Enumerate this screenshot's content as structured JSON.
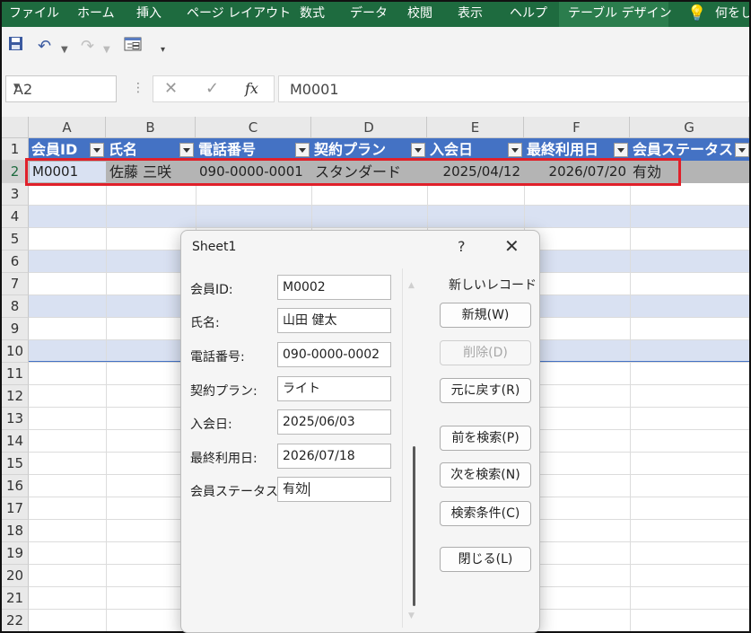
{
  "ribbon": {
    "tabs": [
      "ファイル",
      "ホーム",
      "挿入",
      "ページ レイアウト",
      "数式",
      "データ",
      "校閲",
      "表示",
      "ヘルプ",
      "テーブル デザイン"
    ],
    "tell_me": "何をし"
  },
  "formula_bar": {
    "name_box": "A2",
    "content": "M0001",
    "fx": "fx"
  },
  "grid": {
    "columns": [
      "A",
      "B",
      "C",
      "D",
      "E",
      "F",
      "G"
    ],
    "rows": [
      "1",
      "2",
      "3",
      "4",
      "5",
      "6",
      "7",
      "8",
      "9",
      "10",
      "11",
      "12",
      "13",
      "14",
      "15",
      "16",
      "17",
      "18",
      "19",
      "20",
      "21",
      "22"
    ],
    "header": [
      "会員ID",
      "氏名",
      "電話番号",
      "契約プラン",
      "入会日",
      "最終利用日",
      "会員ステータス"
    ],
    "record": [
      "M0001",
      "佐藤 三咲",
      "090-0000-0001",
      "スタンダード",
      "2025/04/12",
      "2026/07/20",
      "有効"
    ]
  },
  "dialog": {
    "title": "Sheet1",
    "help": "?",
    "close": "✕",
    "record_label": "新しいレコード",
    "fields": [
      {
        "label": "会員ID:",
        "value": "M0002"
      },
      {
        "label": "氏名:",
        "value": "山田 健太"
      },
      {
        "label": "電話番号:",
        "value": "090-0000-0002"
      },
      {
        "label": "契約プラン:",
        "value": "ライト"
      },
      {
        "label": "入会日:",
        "value": "2025/06/03"
      },
      {
        "label": "最終利用日:",
        "value": "2026/07/18"
      },
      {
        "label": "会員ステータス:",
        "value": "有効"
      }
    ],
    "buttons": {
      "new": "新規(W)",
      "delete": "削除(D)",
      "restore": "元に戻す(R)",
      "find_prev": "前を検索(P)",
      "find_next": "次を検索(N)",
      "criteria": "検索条件(C)",
      "close": "閉じる(L)"
    }
  },
  "colors": {
    "ribbon": "#1e6b3f",
    "table_header": "#4472c4",
    "band": "#d9e1f2",
    "highlight": "#e0202a"
  }
}
